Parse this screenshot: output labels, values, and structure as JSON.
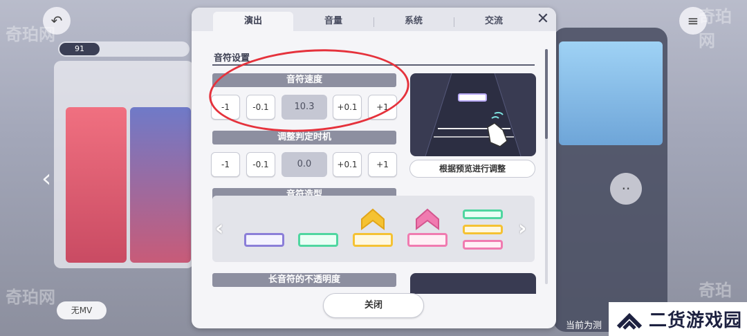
{
  "background": {
    "left_tab": "91",
    "bottom_pill": "无MV",
    "bottom_right_text": "当前为测",
    "watermarks": [
      "奇珀网",
      "奇珀网",
      "奇珀网",
      "奇珀网"
    ]
  },
  "dialog": {
    "tabs": [
      {
        "label": "演出",
        "active": true
      },
      {
        "label": "音量",
        "active": false
      },
      {
        "label": "系统",
        "active": false
      },
      {
        "label": "交流",
        "active": false
      }
    ],
    "close_icon": "close-icon",
    "section_title": "音符设置",
    "note_speed": {
      "label": "音符速度",
      "buttons": [
        "-1",
        "-0.1",
        "+0.1",
        "+1"
      ],
      "value": "10.3"
    },
    "judge_timing": {
      "label": "调整判定时机",
      "buttons": [
        "-1",
        "-0.1",
        "+0.1",
        "+1"
      ],
      "value": "0.0"
    },
    "preview_button": "根据预览进行调整",
    "note_shape": {
      "label": "音符造型",
      "prev_icon": "chevron-left-icon",
      "next_icon": "chevron-right-icon",
      "note_colors": [
        "#8b7ed8",
        "#4fd6a0",
        "#f5c233",
        "#f07bb0"
      ]
    },
    "long_note_opacity": {
      "label": "长音符的不透明度"
    },
    "close_button": "关闭"
  },
  "logo": {
    "text": "二货游戏园"
  },
  "colors": {
    "annotation": "#e5323c",
    "label_bar": "#8d8fa0",
    "preview_bg": "#393b52"
  }
}
